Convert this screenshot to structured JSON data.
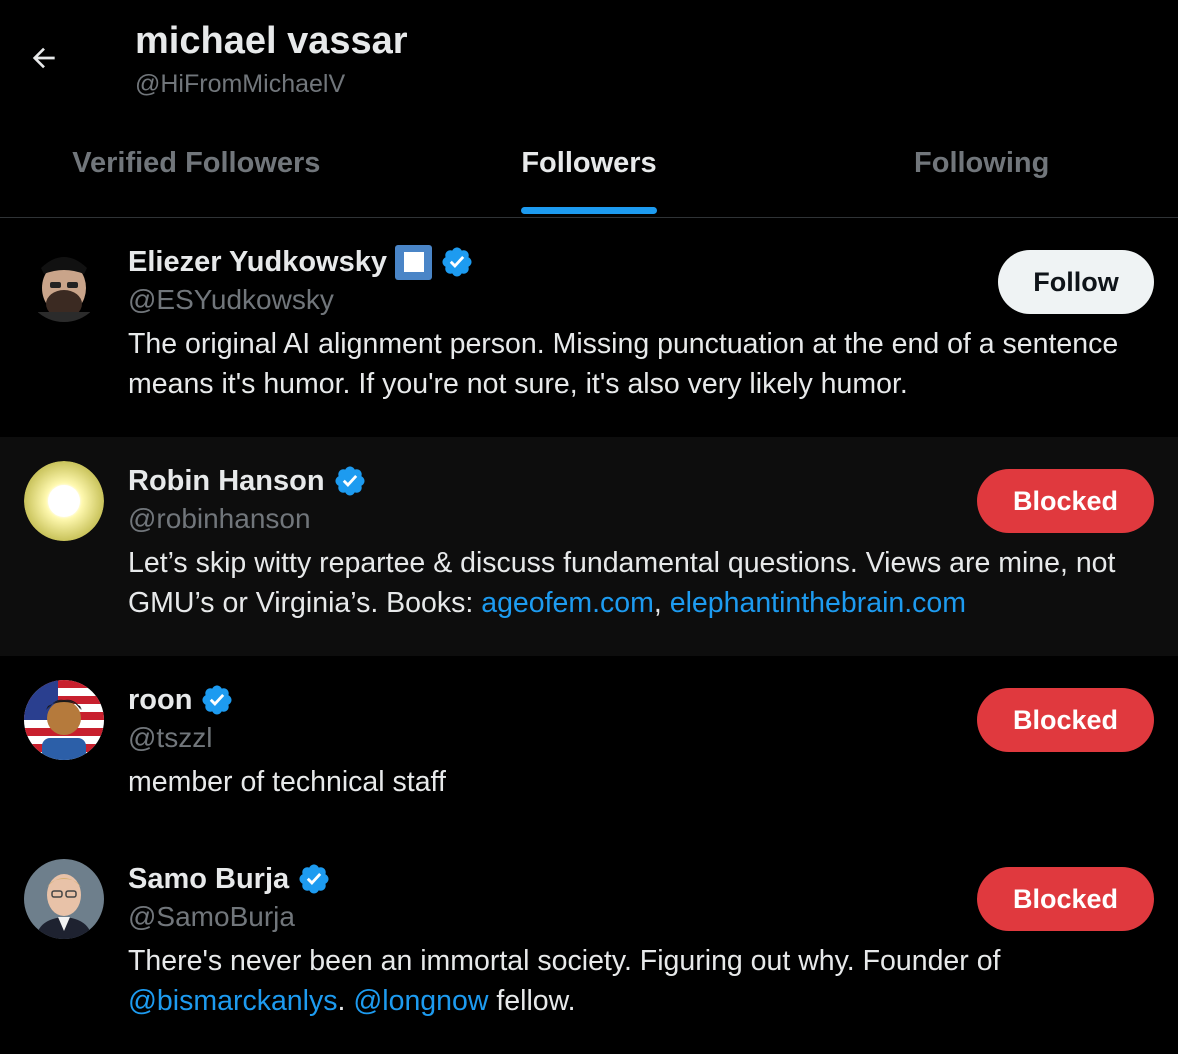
{
  "header": {
    "title": "michael vassar",
    "handle": "@HiFromMichaelV"
  },
  "tabs": [
    {
      "label": "Verified Followers",
      "active": false
    },
    {
      "label": "Followers",
      "active": true
    },
    {
      "label": "Following",
      "active": false
    }
  ],
  "users": [
    {
      "name": "Eliezer Yudkowsky",
      "handle": "@ESYudkowsky",
      "bio": "The original AI alignment person. Missing punctuation at the end of a sentence means it's humor. If you're not sure, it's also very likely humor.",
      "button": "Follow"
    },
    {
      "name": "Robin Hanson",
      "handle": "@robinhanson",
      "bio_text": "Let’s skip witty repartee & discuss fundamental questions. Views are mine, not GMU’s or Virginia’s. Books: ",
      "bio_link1": "ageofem.com",
      "bio_sep": ", ",
      "bio_link2": "elephantinthebrain.com",
      "button": "Blocked"
    },
    {
      "name": "roon",
      "handle": "@tszzl",
      "bio": "member of technical staff",
      "button": "Blocked"
    },
    {
      "name": "Samo Burja",
      "handle": "@SamoBurja",
      "bio_text": "There's never been an immortal society. Figuring out why. Founder of ",
      "bio_link1": "@bismarckanlys",
      "bio_sep": ". ",
      "bio_link2": "@longnow",
      "bio_tail": " fellow.",
      "button": "Blocked"
    }
  ],
  "colors": {
    "accent": "#1d9bf0",
    "blocked": "#e0393e",
    "muted": "#71767b"
  }
}
